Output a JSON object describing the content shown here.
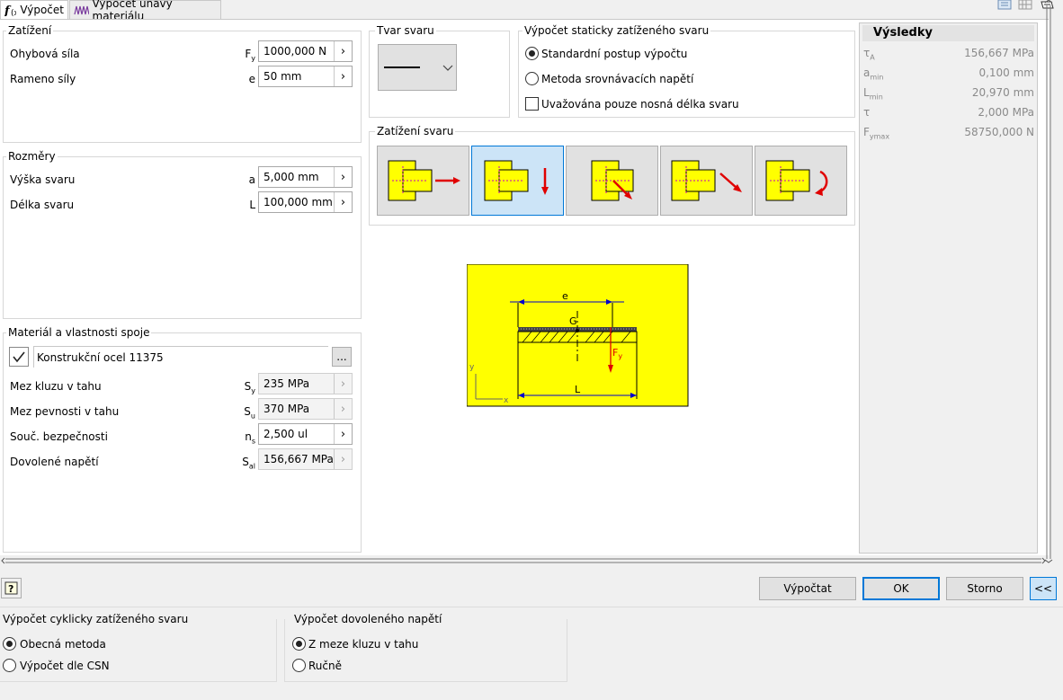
{
  "tabs": [
    {
      "label": "Výpočet",
      "icon": "fx-icon"
    },
    {
      "label": "Výpočet únavy materiálu",
      "icon": "fatigue-chart-icon"
    }
  ],
  "zatizeni": {
    "title": "Zatížení",
    "rows": [
      {
        "label": "Ohybová síla",
        "sym": "F",
        "sub": "y",
        "value": "1000,000 N"
      },
      {
        "label": "Rameno síly",
        "sym": "e",
        "sub": "",
        "value": "50 mm"
      }
    ]
  },
  "rozmery": {
    "title": "Rozměry",
    "rows": [
      {
        "label": "Výška svaru",
        "sym": "a",
        "sub": "",
        "value": "5,000 mm"
      },
      {
        "label": "Délka svaru",
        "sym": "L",
        "sub": "",
        "value": "100,000 mm"
      }
    ]
  },
  "material": {
    "title": "Materiál a vlastnosti spoje",
    "name": "Konstrukční ocel 11375",
    "browse": "...",
    "rows": [
      {
        "label": "Mez kluzu v tahu",
        "sym": "S",
        "sub": "y",
        "value": "235 MPa"
      },
      {
        "label": "Mez pevnosti v tahu",
        "sym": "S",
        "sub": "u",
        "value": "370 MPa"
      },
      {
        "label": "Souč. bezpečnosti",
        "sym": "n",
        "sub": "s",
        "value": "2,500 ul"
      },
      {
        "label": "Dovolené napětí",
        "sym": "S",
        "sub": "al",
        "value": "156,667 MPa"
      }
    ]
  },
  "tvar": {
    "title": "Tvar svaru"
  },
  "staticky": {
    "title": "Výpočet staticky zatíženého svaru",
    "options": [
      "Standardní postup výpočtu",
      "Metoda srovnávacích napětí"
    ],
    "selected": 0,
    "checkbox": "Uvažována pouze nosná délka svaru"
  },
  "zatizeni_svaru": {
    "title": "Zatížení svaru",
    "selected_tile": 1
  },
  "diagram": {
    "dim_e": "e",
    "dim_L": "L",
    "center": "G",
    "force": "F",
    "force_sub": "y",
    "axis_x": "x",
    "axis_y": "y"
  },
  "vysledky": {
    "title": "Výsledky",
    "rows": [
      {
        "sym": "τ",
        "sub": "A",
        "value": "156,667 MPa"
      },
      {
        "sym": "a",
        "sub": "min",
        "value": "0,100 mm"
      },
      {
        "sym": "L",
        "sub": "min",
        "value": "20,970 mm"
      },
      {
        "sym": "τ",
        "sub": "",
        "value": "2,000 MPa"
      },
      {
        "sym": "F",
        "sub": "ymax",
        "value": "58750,000 N"
      }
    ]
  },
  "buttons": {
    "help": "?",
    "calc": "Výpočtat",
    "ok": "OK",
    "cancel": "Storno",
    "collapse": "<<"
  },
  "cyklicky": {
    "title": "Výpočet cyklicky zatíženého svaru",
    "options": [
      "Obecná metoda",
      "Výpočet dle CSN"
    ],
    "selected": 0
  },
  "dovolene": {
    "title": "Výpočet dovoleného napětí",
    "options": [
      "Z meze kluzu v tahu",
      "Ručně"
    ],
    "selected": 0
  },
  "colors": {
    "accent": "#0078d7",
    "plate": "#ffff00",
    "force": "#e00000",
    "dim": "#0000cc"
  }
}
